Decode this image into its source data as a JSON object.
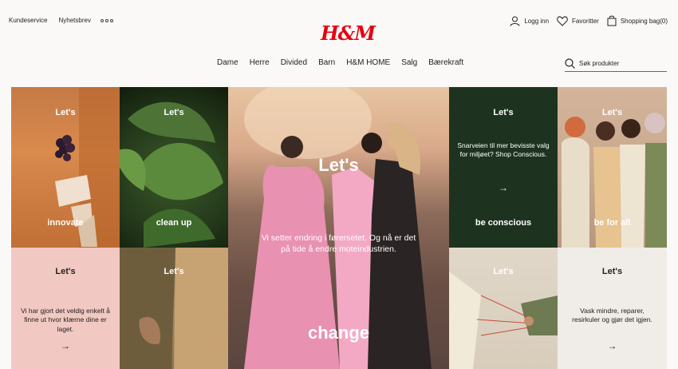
{
  "header": {
    "top_links": [
      "Kundeservice",
      "Nyhetsbrev"
    ],
    "more_icon": "more-dots-icon",
    "logo": "H&M",
    "brand_color": "#e50010",
    "account": {
      "login": "Logg inn",
      "favorites": "Favoritter",
      "bag": "Shopping bag(0)"
    }
  },
  "nav": {
    "items": [
      "Dame",
      "Herre",
      "Divided",
      "Barn",
      "H&M HOME",
      "Salg",
      "Bærekraft"
    ]
  },
  "search": {
    "placeholder": "Søk produkter",
    "icon": "search-icon"
  },
  "tiles": {
    "innovate": {
      "lets": "Let's",
      "label": "innovate"
    },
    "clean_up": {
      "lets": "Let's",
      "label": "clean up"
    },
    "change": {
      "lets": "Let's",
      "text": "Vi setter endring i førersetet. Og nå er det på tide å endre moteindustrien.",
      "label": "change"
    },
    "conscious": {
      "lets": "Let's",
      "text": "Snarveien til mer bevisste valg for miljøet? Shop Conscious.",
      "label": "be conscious",
      "arrow": "→"
    },
    "for_all": {
      "lets": "Let's",
      "label": "be for all"
    },
    "easy": {
      "lets": "Let's",
      "text": "Vi har gjort det veldig enkelt å finne ut hvor klærne dine er laget.",
      "arrow": "→"
    },
    "tile7": {
      "lets": "Let's"
    },
    "tile8": {
      "lets": "Let's"
    },
    "repair": {
      "lets": "Let's",
      "text": "Vask mindre, reparer, resirkuler og gjør det igjen.",
      "arrow": "→"
    }
  }
}
